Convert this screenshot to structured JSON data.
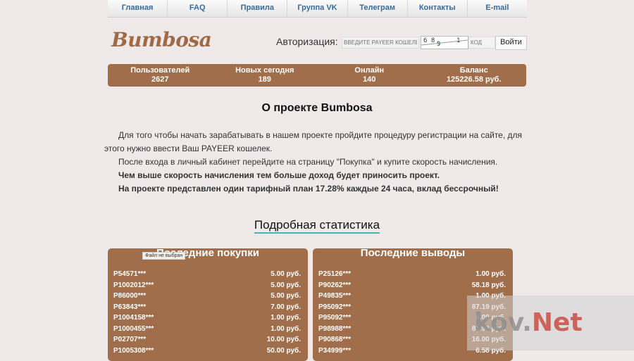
{
  "nav": {
    "items": [
      "Главная",
      "FAQ",
      "Правила",
      "Группа VK",
      "Телеграм",
      "Контакты",
      "E-mail"
    ]
  },
  "logo": "Bumbosa",
  "auth": {
    "label": "Авторизация:",
    "payeer_placeholder": "ВВЕДИТЕ PAYEER КОШЕЛЕК",
    "captcha": [
      "6 8",
      "9",
      "1"
    ],
    "code_placeholder": "КОД",
    "login_button": "Войти"
  },
  "stats": [
    {
      "label": "Пользователей",
      "value": "2627"
    },
    {
      "label": "Новых сегодня",
      "value": "189"
    },
    {
      "label": "Онлайн",
      "value": "140"
    },
    {
      "label": "Баланс",
      "value": "125226.58 руб."
    }
  ],
  "about": {
    "title": "О проекте Bumbosa",
    "p1": "Для того чтобы начать зарабатывать в нашем проекте пройдите процедуру регистрации на сайте, для этого нужно ввести Ваш PAYEER кошелек.",
    "p2": "После входа в личный кабинет перейдите на страницу \"Покупка\" и купите скорость начисления.",
    "p3": "Чем выше скорость начисления тем больше доход будет приносить проект.",
    "p4": "На проекте представлен один тарифный план 17.28% каждые 24 часа, вклад бессрочный!"
  },
  "stats_link": "Подробная статистика",
  "purchases": {
    "title": "Последние покупки",
    "rows": [
      {
        "user": "P54571***",
        "amount": "5.00 руб."
      },
      {
        "user": "P1002012***",
        "amount": "5.00 руб."
      },
      {
        "user": "P86000***",
        "amount": "5.00 руб."
      },
      {
        "user": "P63843***",
        "amount": "7.00 руб."
      },
      {
        "user": "P1004158***",
        "amount": "1.00 руб."
      },
      {
        "user": "P1000455***",
        "amount": "1.00 руб."
      },
      {
        "user": "P02707***",
        "amount": "10.00 руб."
      },
      {
        "user": "P1005308***",
        "amount": "50.00 руб."
      }
    ]
  },
  "withdrawals": {
    "title": "Последние выводы",
    "rows": [
      {
        "user": "P25126***",
        "amount": "1.00 руб."
      },
      {
        "user": "P90262***",
        "amount": "58.18 руб."
      },
      {
        "user": "P49835***",
        "amount": "1.00 руб."
      },
      {
        "user": "P95092***",
        "amount": "87.19 руб."
      },
      {
        "user": "P95092***",
        "amount": "4.00 руб."
      },
      {
        "user": "P98988***",
        "amount": "81.93 руб."
      },
      {
        "user": "P90868***",
        "amount": "16.00 руб."
      },
      {
        "user": "P34999***",
        "amount": "6.58 руб."
      }
    ]
  },
  "file_tooltip": "Файл не выбран",
  "watermark": {
    "prefix": "kov.",
    "suffix": "Net"
  }
}
